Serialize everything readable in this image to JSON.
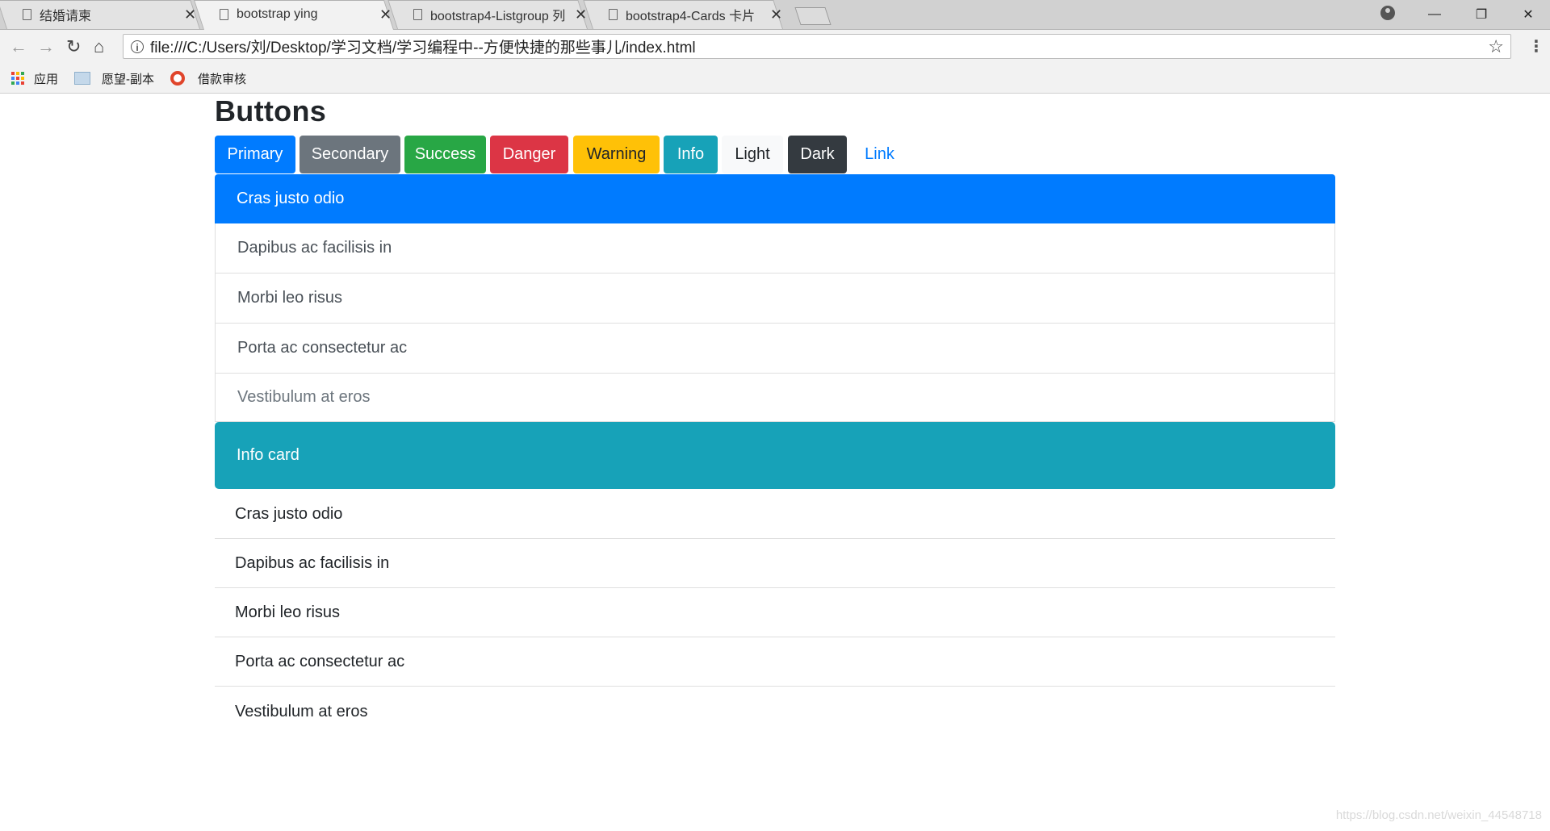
{
  "browser": {
    "tabs": [
      {
        "title": "结婚请柬"
      },
      {
        "title": "bootstrap ying"
      },
      {
        "title": "bootstrap4-Listgroup 列"
      },
      {
        "title": "bootstrap4-Cards 卡片"
      }
    ],
    "url": "file:///C:/Users/刘/Desktop/学习文档/学习编程中--方便快捷的那些事儿/index.html",
    "bookmarks": [
      {
        "label": "应用",
        "icon": "apps-grid-icon"
      },
      {
        "label": "愿望-副本",
        "icon": "folder-icon"
      },
      {
        "label": "借款审核",
        "icon": "target-icon"
      }
    ]
  },
  "page": {
    "heading": "Buttons",
    "buttons": [
      {
        "label": "Primary",
        "bg": "#007bff",
        "fg": "#ffffff"
      },
      {
        "label": "Secondary",
        "bg": "#6c757d",
        "fg": "#ffffff"
      },
      {
        "label": "Success",
        "bg": "#28a745",
        "fg": "#ffffff"
      },
      {
        "label": "Danger",
        "bg": "#dc3545",
        "fg": "#ffffff"
      },
      {
        "label": "Warning",
        "bg": "#ffc107",
        "fg": "#212529"
      },
      {
        "label": "Info",
        "bg": "#17a2b8",
        "fg": "#ffffff"
      },
      {
        "label": "Light",
        "bg": "#f8f9fa",
        "fg": "#212529"
      },
      {
        "label": "Dark",
        "bg": "#343a40",
        "fg": "#ffffff"
      },
      {
        "label": "Link",
        "bg": "transparent",
        "fg": "#007bff"
      }
    ],
    "list_group": {
      "active": "Cras justo odio",
      "items": [
        "Dapibus ac facilisis in",
        "Morbi leo risus",
        "Porta ac consectetur ac"
      ],
      "disabled": "Vestibulum at eros"
    },
    "info_card": {
      "title": "Info card"
    },
    "flush_list": [
      "Cras justo odio",
      "Dapibus ac facilisis in",
      "Morbi leo risus",
      "Porta ac consectetur ac",
      "Vestibulum at eros"
    ]
  },
  "watermark": "https://blog.csdn.net/weixin_44548718"
}
